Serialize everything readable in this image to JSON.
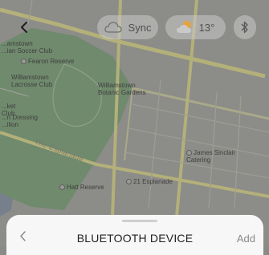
{
  "top_bar": {
    "back_icon": "chevron-left-icon",
    "sync_label": "Sync",
    "weather_temp": "13°",
    "weather_icon": "partly-cloudy-icon",
    "bluetooth_icon": "bluetooth-icon"
  },
  "map": {
    "labels": {
      "williamstown_club": "...amstown\n...ian Soccer Club",
      "fearon_reserve": "Fearon Reserve",
      "lacrosse_club": "Williamstown\nLacrosse Club",
      "botanic_gardens": "Williamstown\nBotanic Gardens",
      "cricket": "...ket\nClub",
      "dressing": "...n Dressing\n...ilion",
      "esplanade_street": "The Esplanade",
      "james_sinclair": "James Sinclair\nCatering",
      "esplanade_21": "21 Esplanade",
      "hatt_reserve": "Hatt Reserve"
    }
  },
  "sheet": {
    "back_icon": "chevron-left-icon",
    "title": "BLUETOOTH DEVICE",
    "add_label": "Add"
  },
  "colors": {
    "map_land": "#8c8c88",
    "park": "#6f8a6c",
    "road": "#b3b07a",
    "sheet_bg": "#f7f7f7"
  }
}
